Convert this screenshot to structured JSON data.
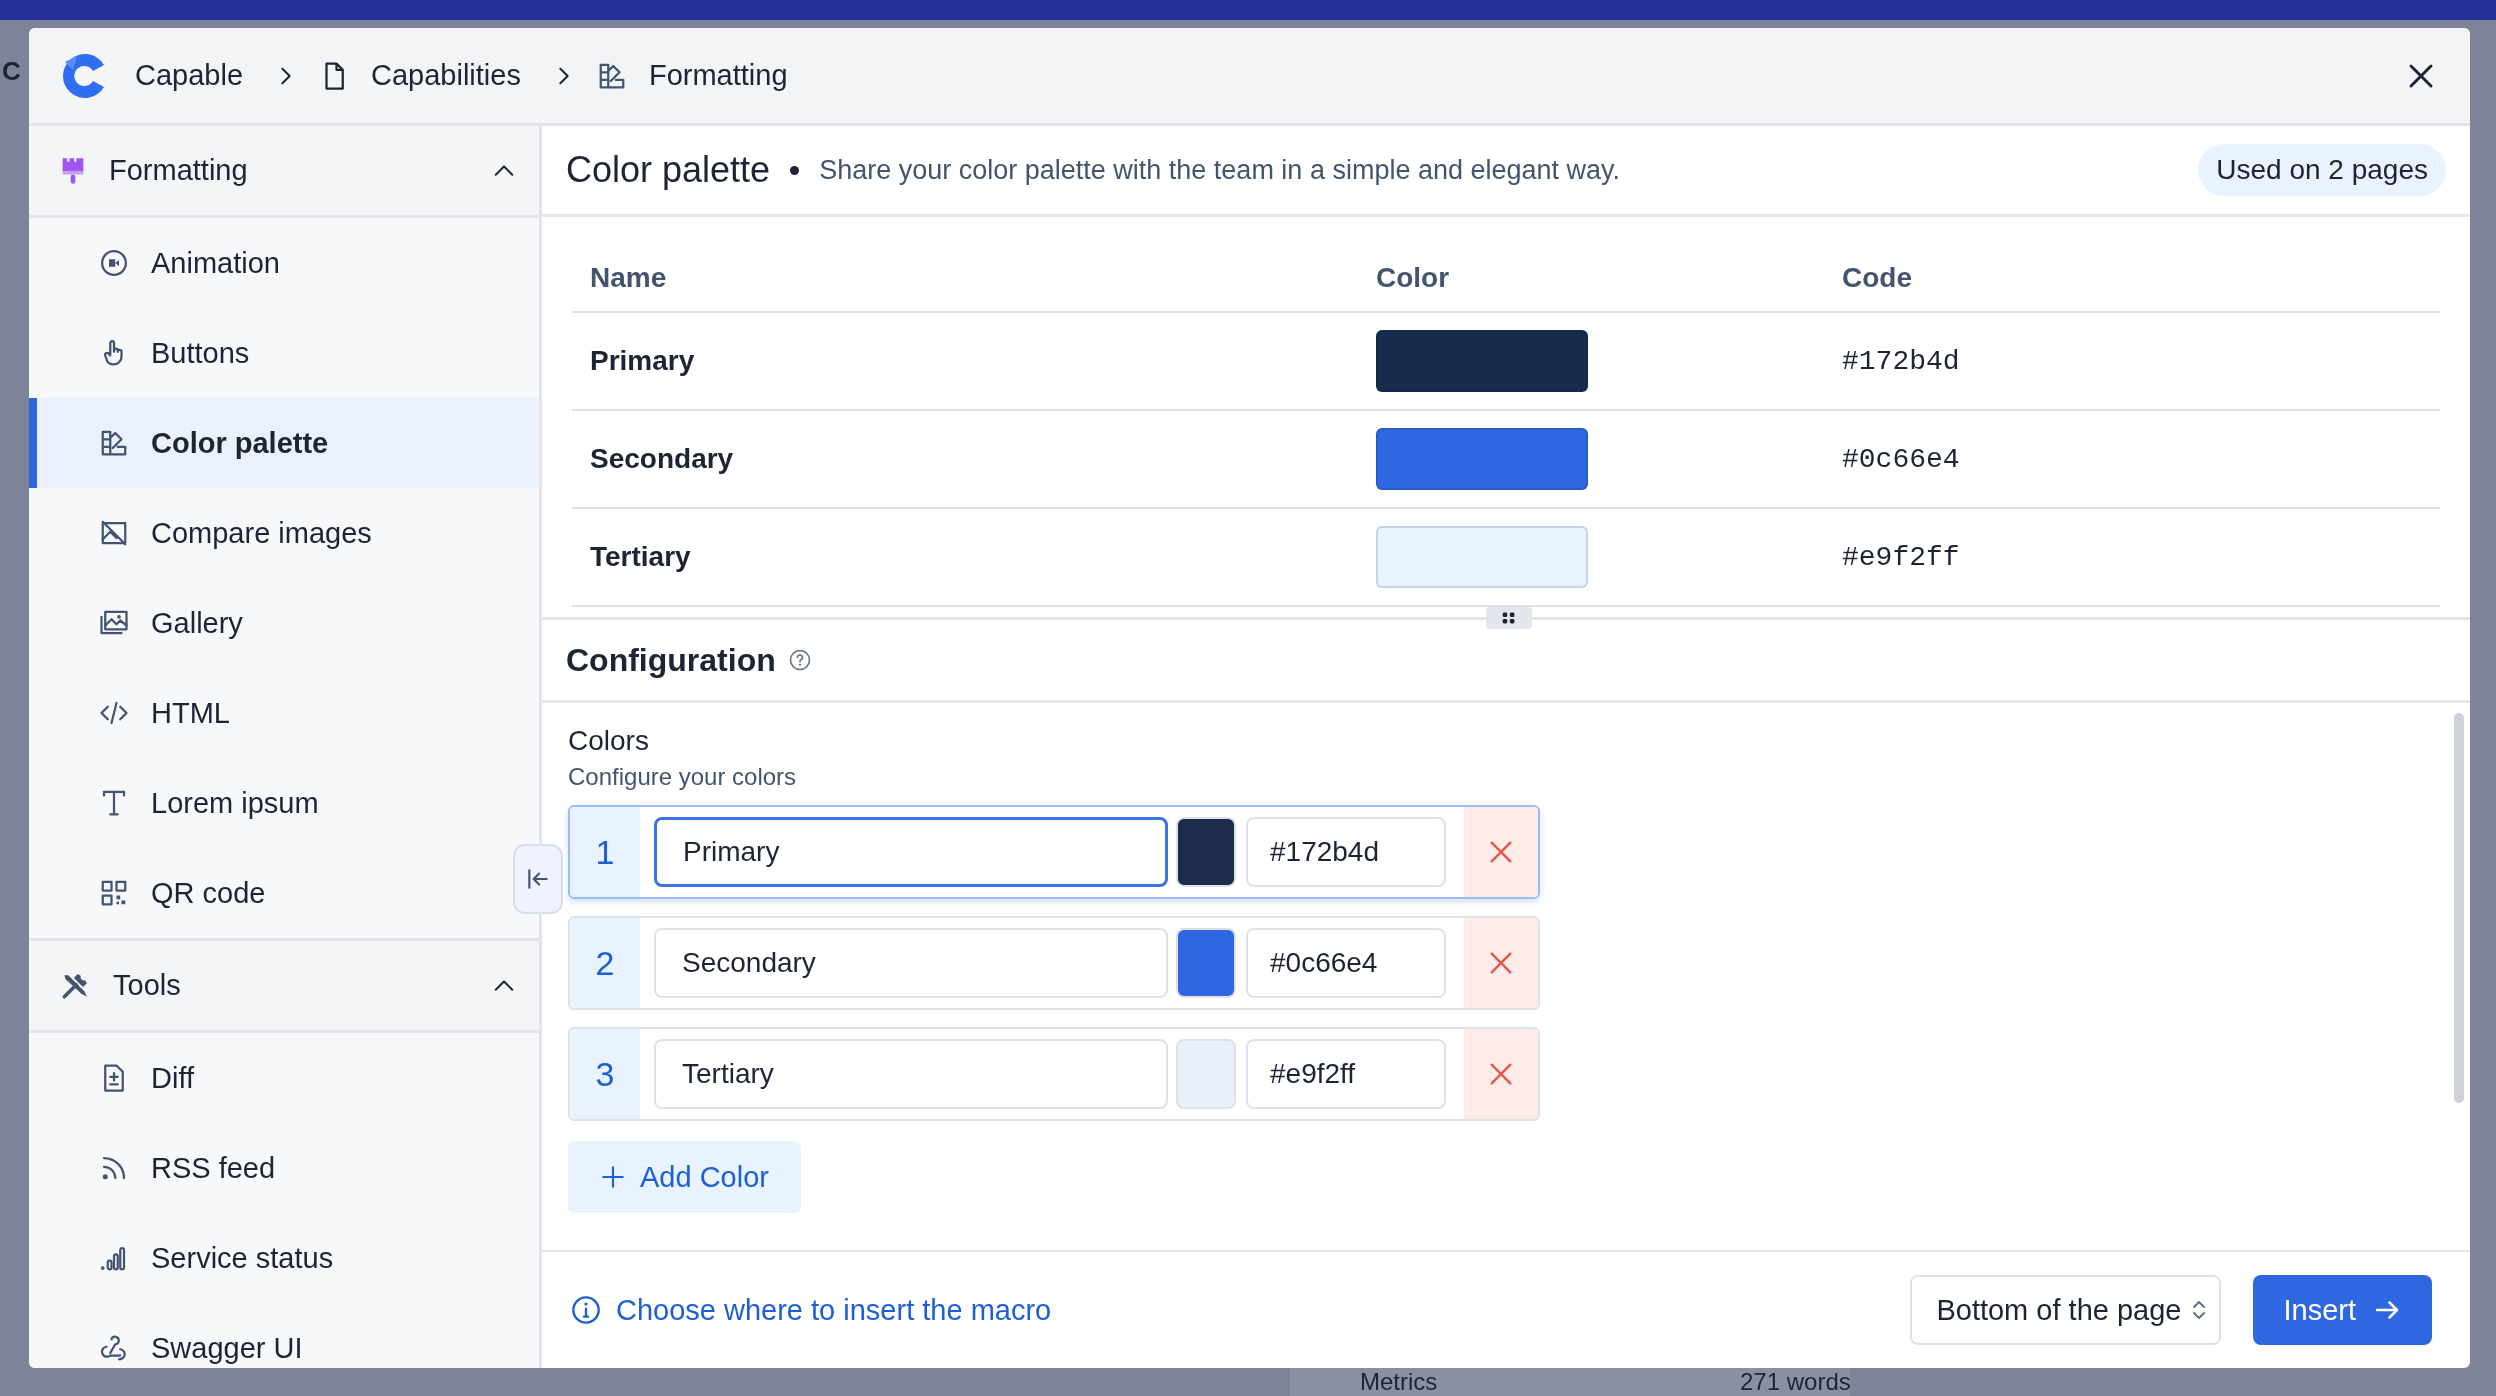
{
  "backdrop": {
    "brand_fragment": "C",
    "footer_item": "Metrics",
    "word_count": "271 words"
  },
  "breadcrumbs": [
    {
      "label": "Capable",
      "kind": "logo"
    },
    {
      "label": "Capabilities",
      "kind": "page"
    },
    {
      "label": "Formatting",
      "kind": "palette"
    }
  ],
  "sidebar": {
    "groups": [
      {
        "label": "Formatting",
        "kind": "brush",
        "expanded": true,
        "items": [
          {
            "label": "Animation",
            "kind": "animation",
            "selected": false
          },
          {
            "label": "Buttons",
            "kind": "hand",
            "selected": false
          },
          {
            "label": "Color palette",
            "kind": "palette",
            "selected": true
          },
          {
            "label": "Compare images",
            "kind": "noimage",
            "selected": false
          },
          {
            "label": "Gallery",
            "kind": "gallery",
            "selected": false
          },
          {
            "label": "HTML",
            "kind": "code",
            "selected": false
          },
          {
            "label": "Lorem ipsum",
            "kind": "text",
            "selected": false
          },
          {
            "label": "QR code",
            "kind": "qr",
            "selected": false
          }
        ]
      },
      {
        "label": "Tools",
        "kind": "tools",
        "expanded": true,
        "items": [
          {
            "label": "Diff",
            "kind": "diff",
            "selected": false
          },
          {
            "label": "RSS feed",
            "kind": "rss",
            "selected": false
          },
          {
            "label": "Service status",
            "kind": "bars",
            "selected": false
          },
          {
            "label": "Swagger UI",
            "kind": "hook",
            "selected": false
          }
        ]
      }
    ]
  },
  "header": {
    "title": "Color palette",
    "description": "Share your color palette with the team in a simple and elegant way.",
    "usage_badge": "Used on 2 pages"
  },
  "table": {
    "columns": [
      "Name",
      "Color",
      "Code"
    ],
    "rows": [
      {
        "name": "Primary",
        "color": "#172b4d",
        "code": "#172b4d"
      },
      {
        "name": "Secondary",
        "color": "#2f67e0",
        "code": "#0c66e4"
      },
      {
        "name": "Tertiary",
        "color": "#e9f2ff",
        "code": "#e9f2ff"
      }
    ]
  },
  "configuration": {
    "title": "Configuration",
    "field_label": "Colors",
    "field_hint": "Configure your colors",
    "entries": [
      {
        "index": "1",
        "name": "Primary",
        "color": "#1c2a4b",
        "code": "#172b4d",
        "focused": true
      },
      {
        "index": "2",
        "name": "Secondary",
        "color": "#2f67e0",
        "code": "#0c66e4",
        "focused": false
      },
      {
        "index": "3",
        "name": "Tertiary",
        "color": "#e9f0fc",
        "code": "#e9f2ff",
        "focused": false
      }
    ],
    "add_button": "Add Color"
  },
  "footer": {
    "info_link": "Choose where to insert the macro",
    "position_select": "Bottom of the page",
    "insert_button": "Insert"
  }
}
